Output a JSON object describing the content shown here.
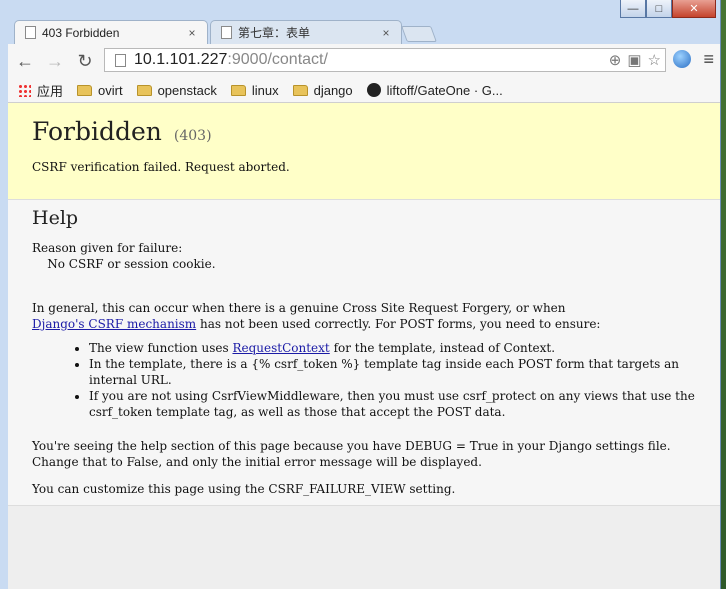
{
  "browser": {
    "tabs": [
      {
        "title": "403 Forbidden",
        "close": "×"
      },
      {
        "title": "第七章：表单",
        "close": "×"
      }
    ],
    "window_controls": {
      "minimize": "—",
      "maximize": "□",
      "close": "✕"
    },
    "url_host": "10.1.101.227",
    "url_path": ":9000/contact/",
    "bookmarks": [
      {
        "label": "应用",
        "icon": "apps-icon"
      },
      {
        "label": "ovirt",
        "icon": "folder-icon"
      },
      {
        "label": "openstack",
        "icon": "folder-icon"
      },
      {
        "label": "linux",
        "icon": "folder-icon"
      },
      {
        "label": "django",
        "icon": "folder-icon"
      },
      {
        "label": "liftoff/GateOne · G...",
        "icon": "github-icon"
      }
    ]
  },
  "page": {
    "title": "Forbidden",
    "code": "(403)",
    "message": "CSRF verification failed. Request aborted.",
    "help_heading": "Help",
    "reason_label": "Reason given for failure:",
    "reason_value": "    No CSRF or session cookie.",
    "general_1": "In general, this can occur when there is a genuine Cross Site Request Forgery, or when",
    "general_link": "Django's CSRF mechanism",
    "general_2": " has not been used correctly. For POST forms, you need to ensure:",
    "bullet1_a": "The view function uses ",
    "bullet1_link": "RequestContext",
    "bullet1_b": " for the template, instead of Context.",
    "bullet2": "In the template, there is a {% csrf_token %} template tag inside each POST form that targets an internal URL.",
    "bullet3": "If you are not using CsrfViewMiddleware, then you must use csrf_protect on any views that use the csrf_token template tag, as well as those that accept the POST data.",
    "debug_note": "You're seeing the help section of this page because you have DEBUG = True in your Django settings file. Change that to False, and only the initial error message will be displayed.",
    "customize_note": "You can customize this page using the CSRF_FAILURE_VIEW setting."
  }
}
